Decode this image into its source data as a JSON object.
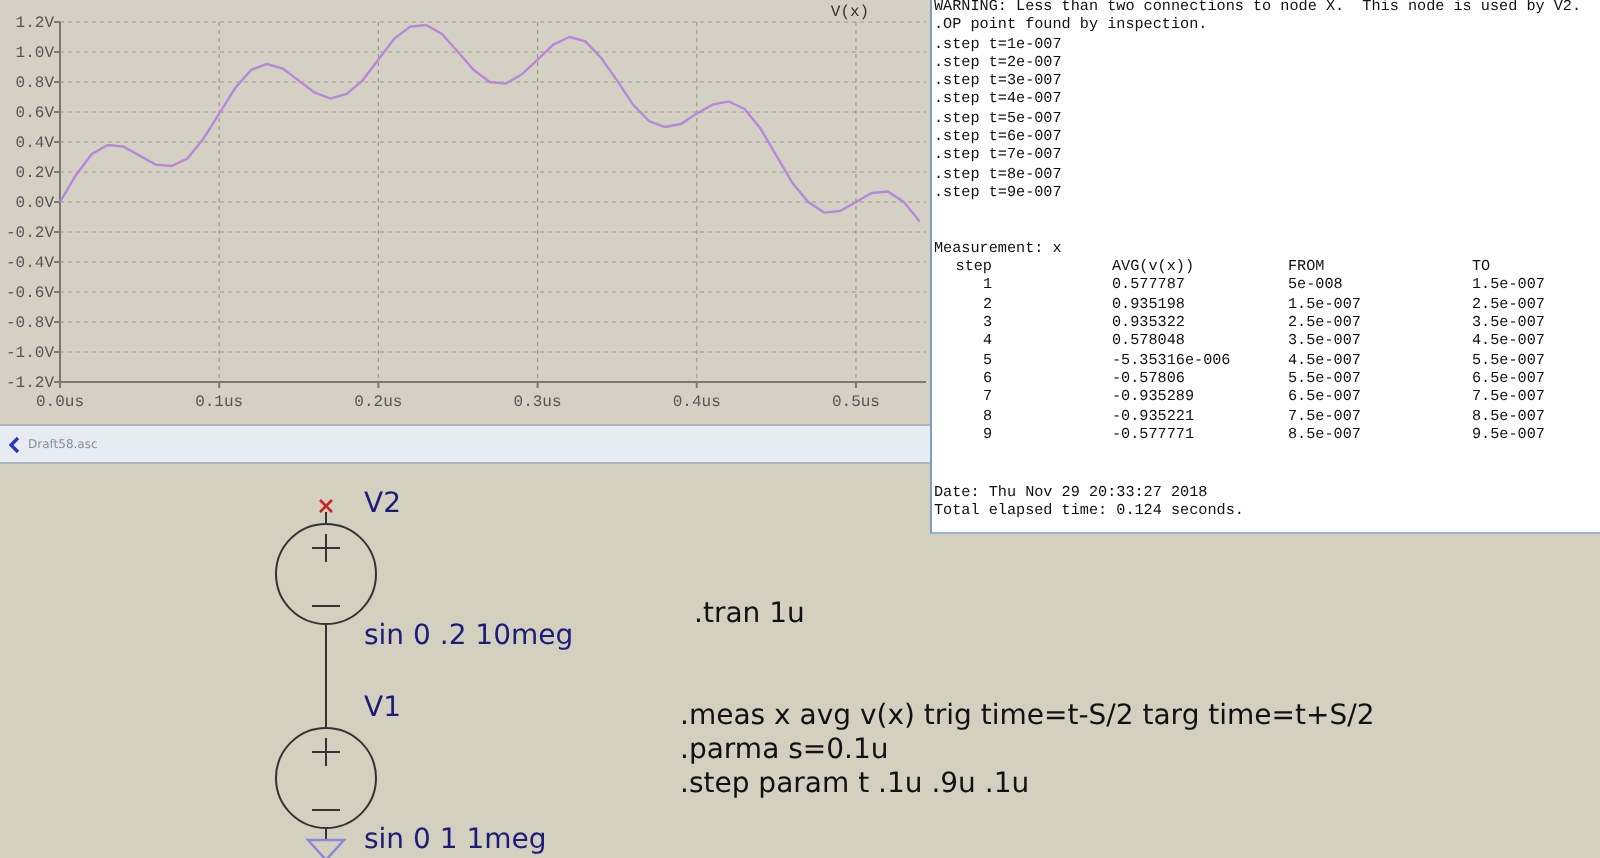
{
  "plot": {
    "chart_data": {
      "type": "line",
      "grid": true,
      "xlim": [
        0,
        0.544
      ],
      "ylim": [
        -1.2,
        1.2
      ],
      "xticks": [
        {
          "value": 0,
          "label": "0.0us"
        },
        {
          "value": 0.1,
          "label": "0.1us"
        },
        {
          "value": 0.2,
          "label": "0.2us"
        },
        {
          "value": 0.3,
          "label": "0.3us"
        },
        {
          "value": 0.4,
          "label": "0.4us"
        },
        {
          "value": 0.5,
          "label": "0.5us"
        }
      ],
      "yticks": [
        {
          "value": 1.2,
          "label": "1.2V"
        },
        {
          "value": 1.0,
          "label": "1.0V"
        },
        {
          "value": 0.8,
          "label": "0.8V"
        },
        {
          "value": 0.6,
          "label": "0.6V"
        },
        {
          "value": 0.4,
          "label": "0.4V"
        },
        {
          "value": 0.2,
          "label": "0.2V"
        },
        {
          "value": 0,
          "label": "0.0V"
        },
        {
          "value": -0.2,
          "label": "-0.2V"
        },
        {
          "value": -0.4,
          "label": "-0.4V"
        },
        {
          "value": -0.6,
          "label": "-0.6V"
        },
        {
          "value": -0.8,
          "label": "-0.8V"
        },
        {
          "value": -1.0,
          "label": "-1.0V"
        },
        {
          "value": -1.2,
          "label": "-1.2V"
        }
      ],
      "x": [
        0,
        0.01,
        0.02,
        0.03,
        0.04,
        0.05,
        0.06,
        0.07,
        0.08,
        0.09,
        0.1,
        0.11,
        0.12,
        0.13,
        0.14,
        0.15,
        0.16,
        0.17,
        0.18,
        0.19,
        0.2,
        0.21,
        0.22,
        0.23,
        0.24,
        0.25,
        0.26,
        0.27,
        0.28,
        0.29,
        0.3,
        0.31,
        0.32,
        0.33,
        0.34,
        0.35,
        0.36,
        0.37,
        0.38,
        0.39,
        0.4,
        0.41,
        0.42,
        0.43,
        0.44,
        0.45,
        0.46,
        0.47,
        0.48,
        0.49,
        0.5,
        0.51,
        0.52,
        0.53,
        0.54
      ],
      "series": [
        {
          "name": "V(x)",
          "color": "#b48ad8",
          "values": [
            0,
            0.18,
            0.32,
            0.38,
            0.37,
            0.31,
            0.25,
            0.24,
            0.29,
            0.42,
            0.59,
            0.76,
            0.88,
            0.92,
            0.89,
            0.81,
            0.73,
            0.69,
            0.72,
            0.81,
            0.95,
            1.09,
            1.17,
            1.18,
            1.12,
            1.0,
            0.88,
            0.8,
            0.79,
            0.85,
            0.95,
            1.05,
            1.1,
            1.07,
            0.96,
            0.81,
            0.65,
            0.54,
            0.5,
            0.52,
            0.59,
            0.65,
            0.67,
            0.62,
            0.49,
            0.31,
            0.13,
            0,
            -0.07,
            -0.06,
            0,
            0.06,
            0.07,
            0,
            -0.13
          ]
        }
      ]
    }
  },
  "log": {
    "messages": [
      "WARNING: Less than two connections to node X.  This node is used by V2.",
      ".OP point found by inspection.",
      ".step t=1e-007",
      ".step t=2e-007",
      ".step t=3e-007",
      ".step t=4e-007",
      ".step t=5e-007",
      ".step t=6e-007",
      ".step t=7e-007",
      ".step t=8e-007",
      ".step t=9e-007"
    ],
    "measurement": {
      "title": "Measurement: x",
      "columns": [
        "step",
        "AVG(v(x))",
        "FROM",
        "TO"
      ],
      "rows": [
        [
          "1",
          "0.577787",
          "5e-008",
          "1.5e-007"
        ],
        [
          "2",
          "0.935198",
          "1.5e-007",
          "2.5e-007"
        ],
        [
          "3",
          "0.935322",
          "2.5e-007",
          "3.5e-007"
        ],
        [
          "4",
          "0.578048",
          "3.5e-007",
          "4.5e-007"
        ],
        [
          "5",
          "-5.35316e-006",
          "4.5e-007",
          "5.5e-007"
        ],
        [
          "6",
          "-0.57806",
          "5.5e-007",
          "6.5e-007"
        ],
        [
          "7",
          "-0.935289",
          "6.5e-007",
          "7.5e-007"
        ],
        [
          "8",
          "-0.935221",
          "7.5e-007",
          "8.5e-007"
        ],
        [
          "9",
          "-0.577771",
          "8.5e-007",
          "9.5e-007"
        ]
      ]
    },
    "footer": [
      "Date: Thu Nov 29 20:33:27 2018",
      "Total elapsed time: 0.124 seconds."
    ]
  },
  "schematic": {
    "tab": {
      "title": "Draft58.asc"
    },
    "components": [
      {
        "kind": "voltage_source",
        "name": "V2",
        "value": "sin 0 .2 10meg",
        "open_terminal": true,
        "grounded": false
      },
      {
        "kind": "voltage_source",
        "name": "V1",
        "value": "sin 0 1 1meg",
        "open_terminal": false,
        "grounded": true
      }
    ],
    "directives": [
      {
        "lines": [
          ".tran 1u"
        ]
      },
      {
        "lines": [
          ".meas x avg v(x) trig time=t-S/2 targ time=t+S/2",
          ".parma s=0.1u",
          ".step param t .1u .9u .1u"
        ]
      }
    ]
  }
}
